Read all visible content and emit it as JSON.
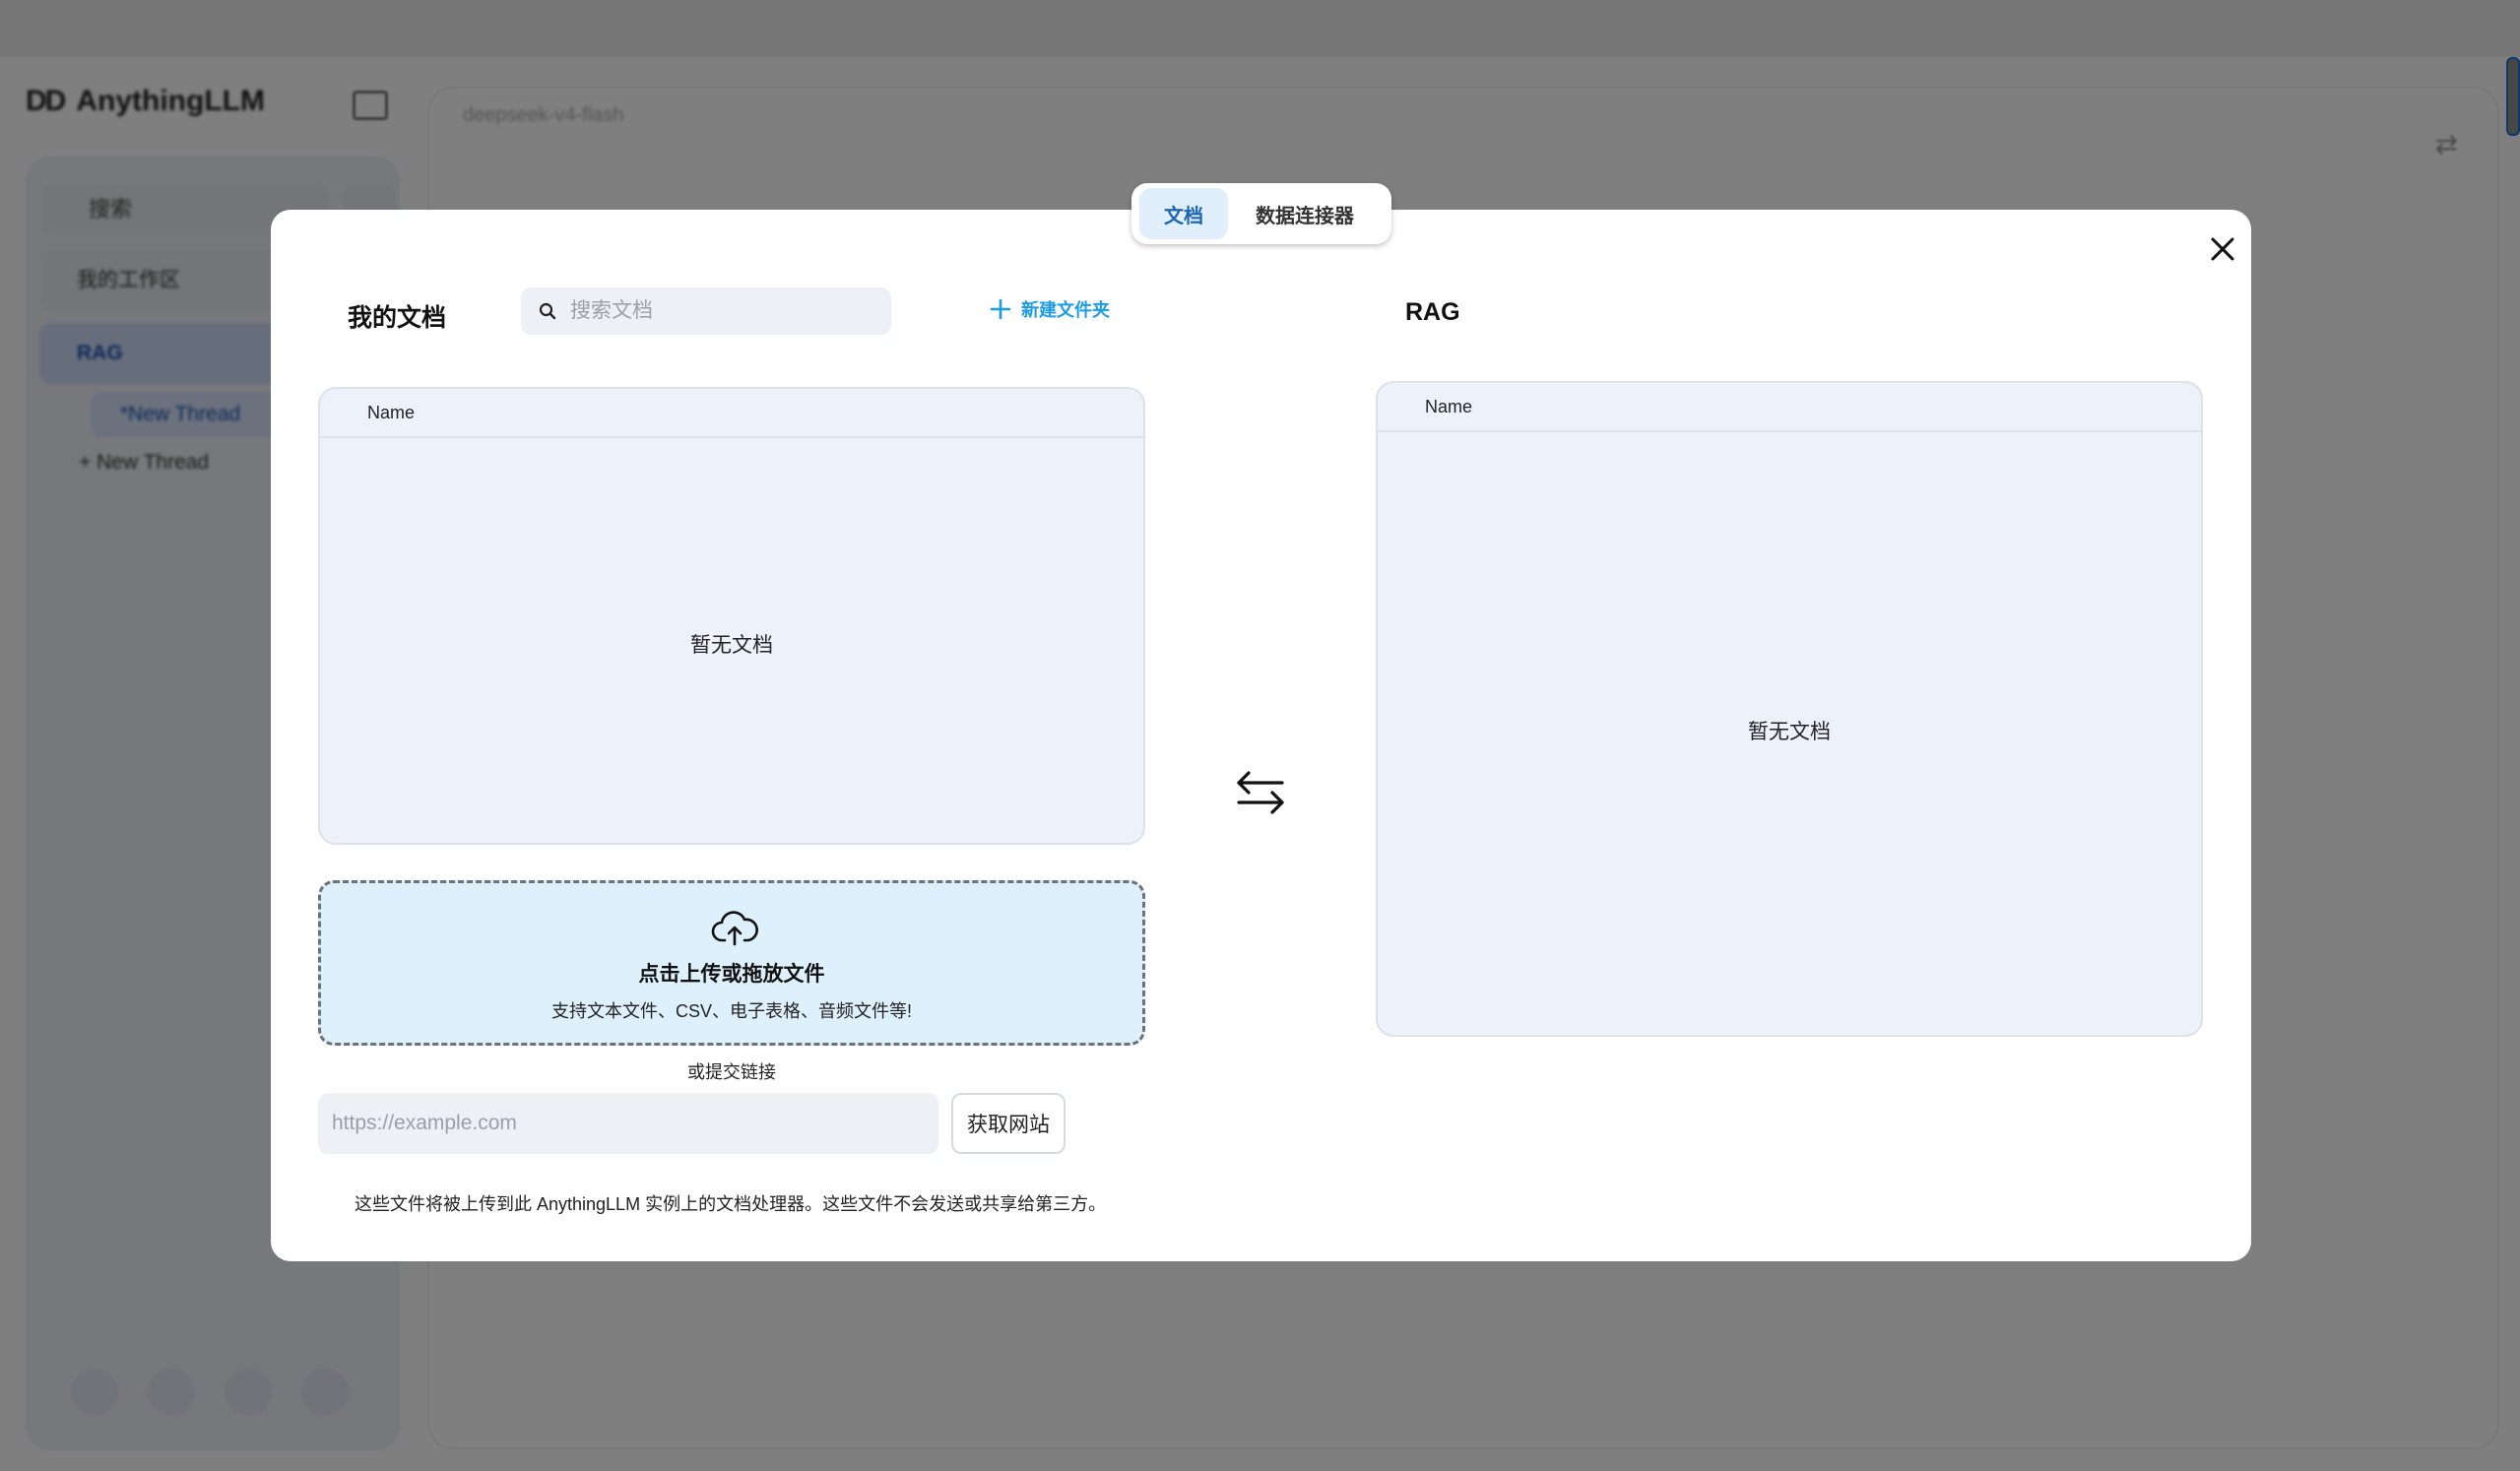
{
  "background": {
    "brand_name": "AnythingLLM",
    "brand_logo": "DD",
    "sidebar": {
      "search_label": "搜索",
      "workspaces_label": "我的工作区",
      "active_workspace": "RAG",
      "active_thread": "*New Thread",
      "new_thread_label": "New Thread"
    },
    "model_name": "deepseek-v4-flash"
  },
  "modal": {
    "tabs": [
      {
        "label": "文档",
        "active": true
      },
      {
        "label": "数据连接器",
        "active": false
      }
    ],
    "my_documents": {
      "title": "我的文档",
      "search_placeholder": "搜索文档",
      "new_folder_label": "新建文件夹",
      "column_name": "Name",
      "empty_text": "暂无文档"
    },
    "upload": {
      "title": "点击上传或拖放文件",
      "subtitle": "支持文本文件、CSV、电子表格、音频文件等!",
      "or_link_label": "或提交链接",
      "url_placeholder": "https://example.com",
      "fetch_button": "获取网站",
      "disclaimer": "这些文件将被上传到此 AnythingLLM 实例上的文档处理器。这些文件不会发送或共享给第三方。"
    },
    "workspace": {
      "title": "RAG",
      "column_name": "Name",
      "empty_text": "暂无文档"
    }
  },
  "colors": {
    "accent": "#1d9be6",
    "tab_active_bg": "#e1eefb",
    "tab_active_text": "#1c67b3",
    "dropzone_bg": "#dff0fd",
    "panel_bg": "#edf1f9"
  }
}
